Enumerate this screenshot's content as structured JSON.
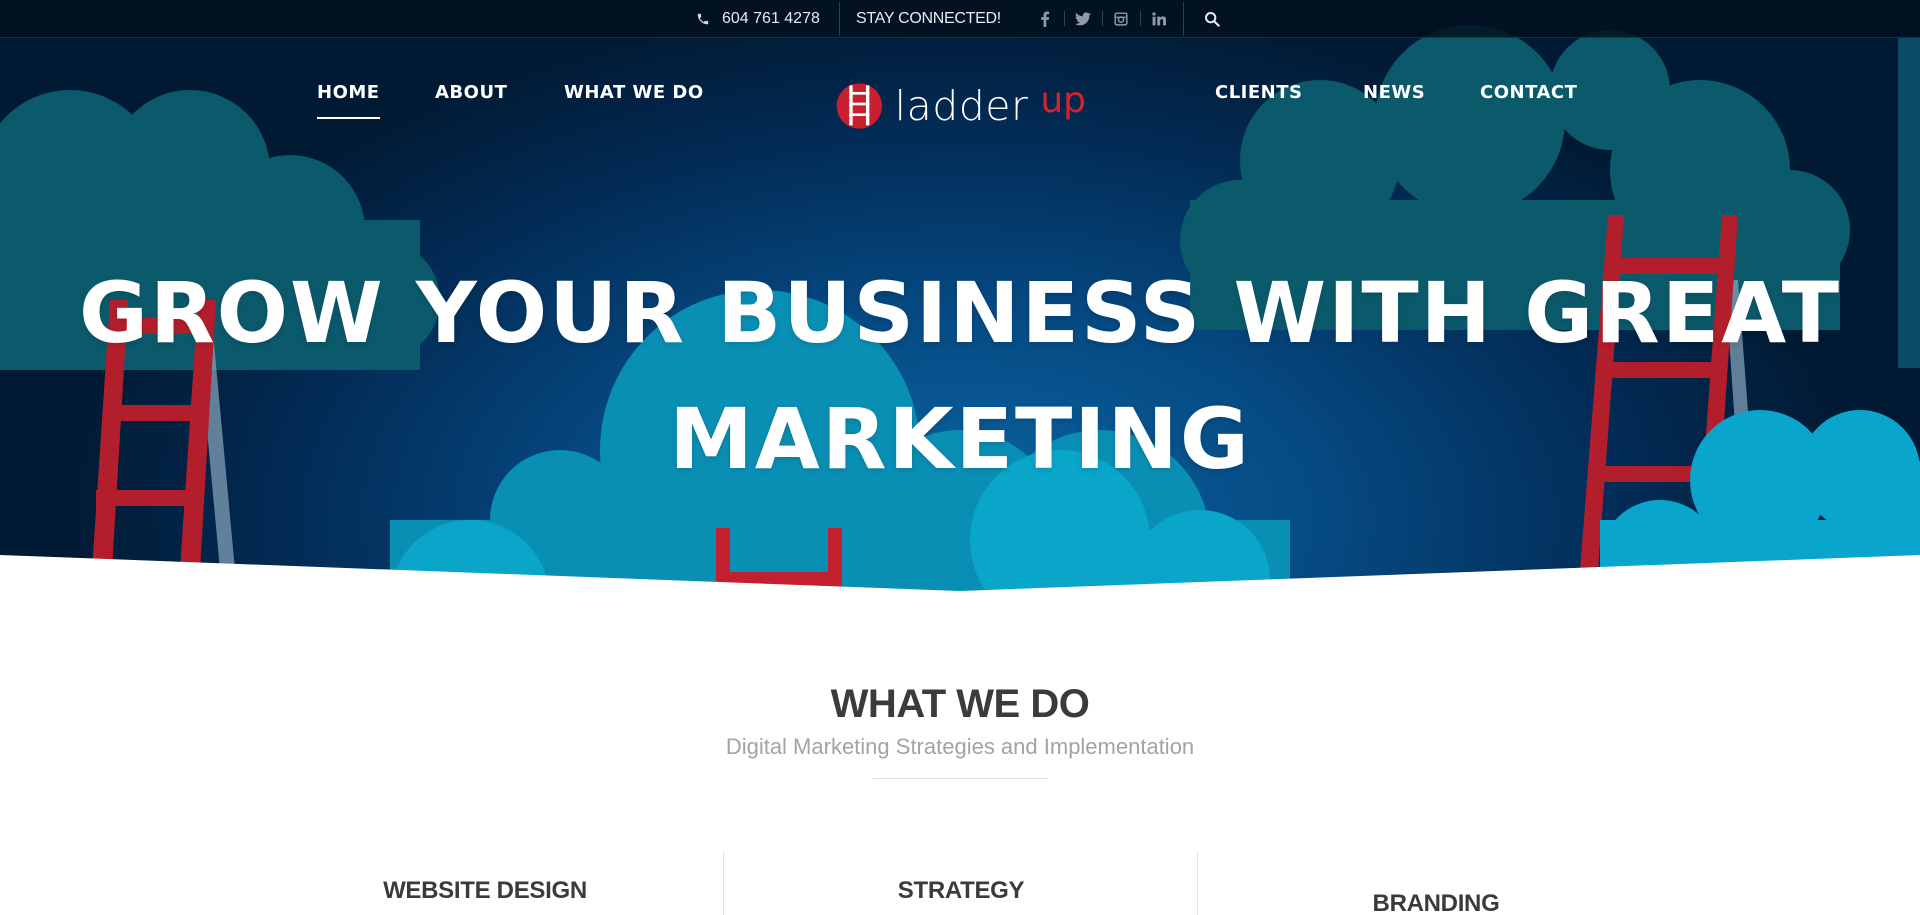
{
  "topbar": {
    "phone": "604 761 4278",
    "stay_connected": "STAY CONNECTED!",
    "social": [
      {
        "name": "facebook",
        "glyph": "f"
      },
      {
        "name": "twitter",
        "glyph": "t"
      },
      {
        "name": "instagram",
        "glyph": "ig"
      },
      {
        "name": "linkedin",
        "glyph": "in"
      }
    ]
  },
  "nav": {
    "home": "HOME",
    "about": "ABOUT",
    "what_we_do": "WHAT WE DO",
    "clients": "CLIENTS",
    "news": "NEWS",
    "contact": "CONTACT",
    "active": "HOME"
  },
  "logo": {
    "word": "ladder",
    "accent": "up"
  },
  "hero": {
    "line1": "GROW YOUR BUSINESS WITH GREAT",
    "line2": "MARKETING"
  },
  "section": {
    "title": "WHAT WE DO",
    "subtitle": "Digital Marketing Strategies and Implementation"
  },
  "services": [
    {
      "title": "WEBSITE DESIGN"
    },
    {
      "title": "STRATEGY"
    },
    {
      "title": "BRANDING"
    }
  ],
  "colors": {
    "brand_red": "#c8202f",
    "cloud_dark": "#0b5d6f",
    "cloud_light": "#0aa5c9",
    "sky_dark": "#011a33",
    "text_dark": "#3b3b3b"
  }
}
